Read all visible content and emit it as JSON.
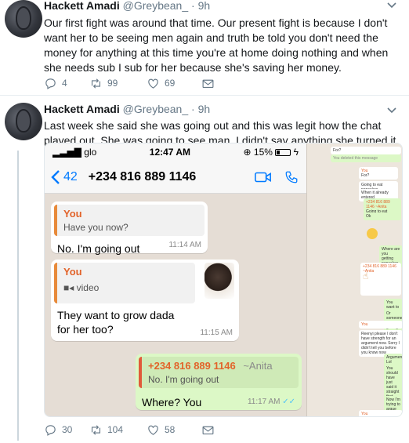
{
  "tweets": [
    {
      "name": "Hackett Amadi",
      "handle": "@Greybean_",
      "time": "· 9h",
      "text": "Our first fight was around that time. Our present fight is because I don't want her to be seeing men again and truth be told you don't need the money for anything at this time you're at home doing nothing and when she needs sub I sub for her because she's saving her money.",
      "replies": "4",
      "retweets": "99",
      "likes": "69"
    },
    {
      "name": "Hackett Amadi",
      "handle": "@Greybean_",
      "time": "· 9h",
      "text": "Last week she said she was going out and this was legit how the chat played out. She was going to see man. I didn't say anything she turned it to fight",
      "replies": "30",
      "retweets": "104",
      "likes": "58"
    }
  ],
  "phone": {
    "carrier": "glo",
    "clock": "12:47 AM",
    "battery": "15%",
    "back_count": "42",
    "contact": "+234 816 889 1146",
    "messages": [
      {
        "quote_author": "You",
        "quote_text": "Have you now?",
        "text": "No. I'm going out",
        "time": "11:14 AM"
      },
      {
        "quote_author": "You",
        "quote_text": "video",
        "text": "They want to grow dada for her too?",
        "time": "11:15 AM"
      },
      {
        "quote_author": "+234 816 889 1146",
        "quote_suffix": "~Anita",
        "quote_text": "No. I'm going out",
        "text": "Where? You",
        "time": "11:17 AM",
        "ticks": "✓✓"
      }
    ]
  },
  "side_chat": [
    {
      "text": "For?"
    },
    {
      "text": "You deleted this message"
    },
    {
      "text": "You"
    },
    {
      "text": "For?"
    },
    {
      "text": "Going to eat pancakes"
    },
    {
      "text": "When it already entered"
    },
    {
      "text": "+234 816 889 1146 ~Anita"
    },
    {
      "text": "Going to eat pancakes"
    },
    {
      "text": "Ok"
    },
    {
      "text": "Where are you getting pancakes"
    },
    {
      "text": "+234 816 889 1146 ~Anita"
    },
    {
      "text": "You want to go there and buy?"
    },
    {
      "text": "Or someone is getting for you"
    },
    {
      "text": "You"
    },
    {
      "text": "Reenyi please I don't have strength for an argument now. Sorry I didn't tell you before you know now"
    },
    {
      "text": "Argument? Lol Anita I wasn't arguing"
    },
    {
      "text": "You should have just said it straight that someone is getting me me pancakes not I'm going to Jibowu to eat pancakes"
    },
    {
      "text": "Now I'm trying to argue sigh anyhow"
    },
    {
      "text": "You"
    }
  ]
}
